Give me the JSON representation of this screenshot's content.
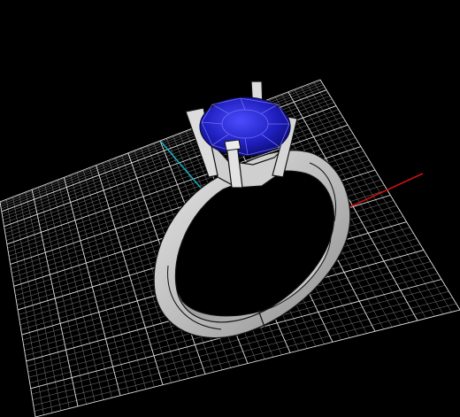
{
  "viewport": {
    "view_name": "Perspective",
    "background_color": "#000000"
  },
  "grid": {
    "visible": true,
    "minor_line_color": "#8a8a8a",
    "major_line_color": "#e0e0e0"
  },
  "axes": {
    "x_axis_color": "#cc1111",
    "y_axis_color": "#1aa8b8"
  },
  "model": {
    "name": "solitaire-ring",
    "parts": [
      {
        "name": "shank",
        "material": "silver",
        "color": "#c9c9c9"
      },
      {
        "name": "four-prong-head",
        "material": "silver",
        "color": "#d4d4d4"
      },
      {
        "name": "round-gemstone",
        "material": "sapphire",
        "color": "#2323c8"
      }
    ]
  }
}
